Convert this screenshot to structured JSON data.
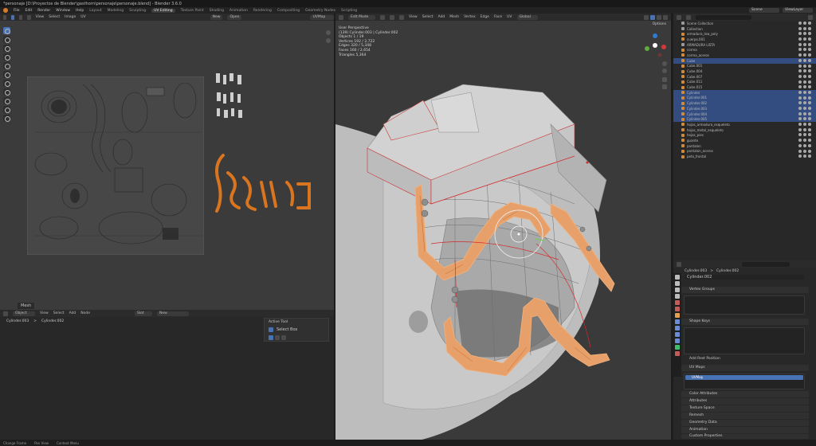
{
  "window": {
    "title": "*personaje [D:\\Proyectos de Blender\\gasthorn\\personaje\\personaje.blend] - Blender 3.6.0"
  },
  "menu": {
    "items": [
      "File",
      "Edit",
      "Render",
      "Window",
      "Help"
    ],
    "workspaces": [
      "Layout",
      "Modeling",
      "Sculpting",
      "UV Editing",
      "Texture Paint",
      "Shading",
      "Animation",
      "Rendering",
      "Compositing",
      "Geometry Nodes",
      "Scripting"
    ],
    "active_workspace": "UV Editing",
    "scene": "Scene",
    "view_layer": "ViewLayer"
  },
  "uv_editor": {
    "menus": [
      "View",
      "Select",
      "Image",
      "UV"
    ],
    "new_label": "New",
    "open_label": "Open",
    "uvmap_field": "UVMap"
  },
  "bottom_left": {
    "mode": "Object",
    "menus": [
      "View",
      "Select",
      "Add",
      "Node"
    ],
    "slot": "Slot",
    "material_new": "New",
    "breadcrumb_a": "Cylinder.003",
    "breadcrumb_b": "Cylinder.002",
    "mesh_label": "Mesh",
    "tool_panel": {
      "header": "Active Tool",
      "tool": "Select Box"
    }
  },
  "viewport": {
    "mode": "Edit Mode",
    "menus": [
      "View",
      "Select",
      "Add",
      "Mesh",
      "Vertex",
      "Edge",
      "Face",
      "UV"
    ],
    "transform": "Global",
    "options": "Options",
    "info": {
      "perspective": "User Perspective",
      "object": "(139) Cylinder.003 | Cylinder.002",
      "objects": "Objects   1 / 19",
      "vertices": "Vertices   192 / 2,722",
      "edges": "Edges   320 / 5,348",
      "faces": "Faces   160 / 2,654",
      "triangles": "Triangles   5,364"
    }
  },
  "outliner": {
    "search": "",
    "rows": [
      {
        "name": "Scene Collection",
        "sel": false,
        "color": "#9a9a9a"
      },
      {
        "name": "Collection",
        "sel": false,
        "color": "#9a9a9a"
      },
      {
        "name": "armadura_low_poly",
        "sel": false,
        "color": "#d08b3a"
      },
      {
        "name": "cuerpo.001",
        "sel": false,
        "color": "#d08b3a"
      },
      {
        "name": "ARMADURA LISTA",
        "sel": false,
        "color": "#9a9a9a"
      },
      {
        "name": "correa",
        "sel": false,
        "color": "#d08b3a"
      },
      {
        "name": "correa_aceros",
        "sel": false,
        "color": "#d08b3a"
      },
      {
        "name": "Cube",
        "sel": true,
        "color": "#d08b3a"
      },
      {
        "name": "Cube.001",
        "sel": false,
        "color": "#d08b3a"
      },
      {
        "name": "Cube.004",
        "sel": false,
        "color": "#d08b3a"
      },
      {
        "name": "Cube.007",
        "sel": false,
        "color": "#d08b3a"
      },
      {
        "name": "Cube.011",
        "sel": false,
        "color": "#d08b3a"
      },
      {
        "name": "Cube.015",
        "sel": false,
        "color": "#d08b3a"
      },
      {
        "name": "Cylinder",
        "sel": true,
        "color": "#d08b3a"
      },
      {
        "name": "Cylinder.001",
        "sel": true,
        "color": "#d08b3a"
      },
      {
        "name": "Cylinder.002",
        "sel": true,
        "color": "#d08b3a"
      },
      {
        "name": "Cylinder.003",
        "sel": true,
        "color": "#d08b3a"
      },
      {
        "name": "Cylinder.004",
        "sel": true,
        "color": "#d08b3a"
      },
      {
        "name": "Cylinder.005",
        "sel": true,
        "color": "#d08b3a"
      },
      {
        "name": "hojas_armadura_esqueleto",
        "sel": false,
        "color": "#d08b3a"
      },
      {
        "name": "hojas_metal_esqueleto",
        "sel": false,
        "color": "#d08b3a"
      },
      {
        "name": "hojas_pies",
        "sel": false,
        "color": "#d08b3a"
      },
      {
        "name": "guante",
        "sel": false,
        "color": "#d08b3a"
      },
      {
        "name": "pantalon",
        "sel": false,
        "color": "#d08b3a"
      },
      {
        "name": "pantalon_aceros",
        "sel": false,
        "color": "#d08b3a"
      },
      {
        "name": "peto_frontal",
        "sel": false,
        "color": "#d08b3a"
      }
    ]
  },
  "properties": {
    "breadcrumb_a": "Cylinder.003",
    "breadcrumb_b": "Cylinder.002",
    "mesh_name": "Cylinder.002",
    "sections": {
      "vertex_groups": "Vertex Groups",
      "shape_keys": "Shape Keys",
      "rest_position": "Add Rest Position",
      "uv_maps": "UV Maps",
      "uv_map_item": "UVMap",
      "color_attributes": "Color Attributes",
      "attributes": "Attributes",
      "texture_space": "Texture Space",
      "remesh": "Remesh",
      "geometry_data": "Geometry Data",
      "animation": "Animation",
      "custom_properties": "Custom Properties"
    }
  },
  "status": {
    "a": "Change Frame",
    "b": "Pan View",
    "c": "Context Menu"
  }
}
